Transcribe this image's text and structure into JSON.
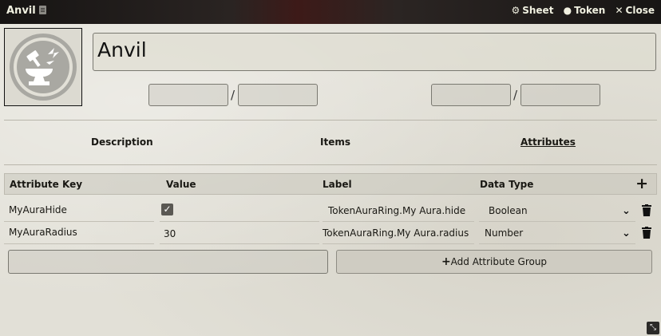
{
  "window": {
    "title": "Anvil",
    "controls": {
      "sheet_icon": "gear-icon",
      "sheet_label": "Sheet",
      "token_icon": "user-circle-icon",
      "token_label": "Token",
      "close_icon": "close-icon",
      "close_label": "Close"
    }
  },
  "profile": {
    "icon": "anvil-icon",
    "name": "Anvil",
    "fields": [
      "",
      "",
      "",
      ""
    ]
  },
  "tabs": [
    {
      "label": "Description",
      "active": false
    },
    {
      "label": "Items",
      "active": false
    },
    {
      "label": "Attributes",
      "active": true
    }
  ],
  "attributes": {
    "columns": [
      "Attribute Key",
      "Value",
      "Label",
      "Data Type"
    ],
    "add_symbol": "+",
    "rows": [
      {
        "key": "MyAuraHide",
        "value": "",
        "checked": true,
        "label": "TokenAuraRing.My Aura.hide",
        "dtype": "Boolean"
      },
      {
        "key": "MyAuraRadius",
        "value": "30",
        "checked": false,
        "label": "TokenAuraRing.My Aura.radius",
        "dtype": "Number"
      }
    ],
    "group_input_value": "",
    "add_group_label": "Add Attribute Group",
    "add_group_icon": "plus-icon"
  },
  "colors": {
    "header_bg": "#161413",
    "parchment": "#e2e0d7",
    "border": "#7a7971"
  }
}
